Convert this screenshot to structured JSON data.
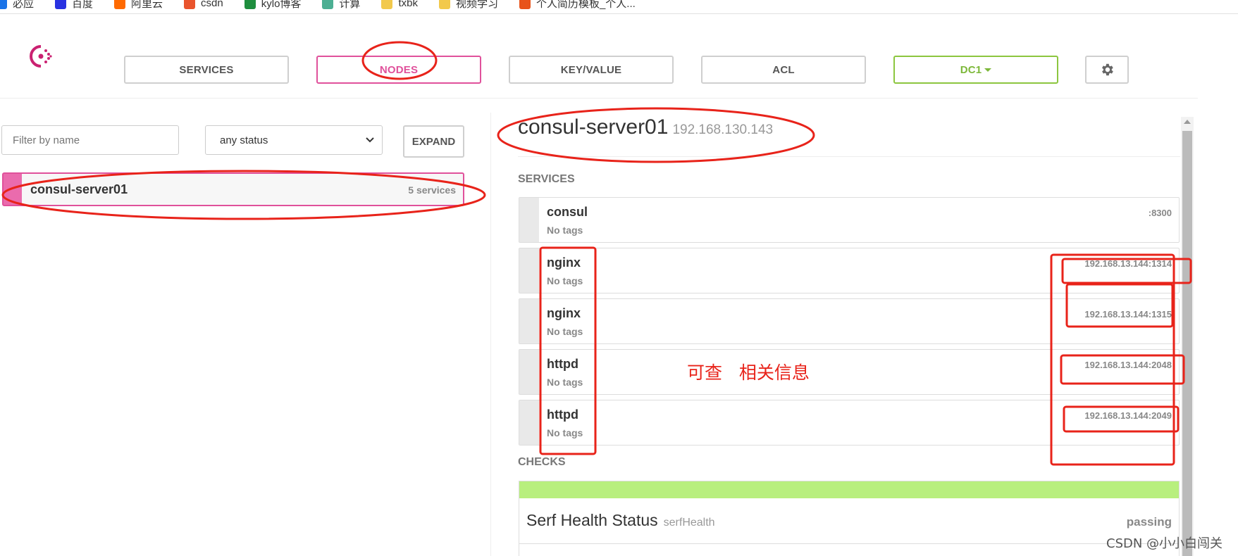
{
  "bookmarks": [
    {
      "label": "必应",
      "color": "#1a73e8"
    },
    {
      "label": "百度",
      "color": "#2932e1"
    },
    {
      "label": "阿里云",
      "color": "#ff6a00"
    },
    {
      "label": "csdn",
      "color": "#e9542d"
    },
    {
      "label": "kylo博客",
      "color": "#1e8e3e"
    },
    {
      "label": "计算",
      "color": "#4caf93"
    },
    {
      "label": "txbk",
      "color": "#f2c94c"
    },
    {
      "label": "视频学习",
      "color": "#f2c94c"
    },
    {
      "label": "个人简历模板_个人...",
      "color": "#e8531a"
    }
  ],
  "nav": {
    "services": "SERVICES",
    "nodes": "NODES",
    "keyvalue": "KEY/VALUE",
    "acl": "ACL",
    "dc": "DC1",
    "settings_icon": "gear-icon"
  },
  "colors": {
    "accent": "#e0519b",
    "dc_green": "#8cc63f",
    "passing": "#b8ef7e",
    "annotation": "#e8231a"
  },
  "filters": {
    "name_placeholder": "Filter by name",
    "status_value": "any status",
    "expand": "EXPAND"
  },
  "nodes": [
    {
      "name": "consul-server01",
      "services": "5 services"
    }
  ],
  "detail": {
    "node_name": "consul-server01",
    "node_ip": "192.168.130.143",
    "services_heading": "SERVICES",
    "checks_heading": "CHECKS",
    "services": [
      {
        "name": "consul",
        "tags": "No tags",
        "address": ":8300"
      },
      {
        "name": "nginx",
        "tags": "No tags",
        "address": "192.168.13.144:1314"
      },
      {
        "name": "nginx",
        "tags": "No tags",
        "address": "192.168.13.144:1315"
      },
      {
        "name": "httpd",
        "tags": "No tags",
        "address": "192.168.13.144:2048"
      },
      {
        "name": "httpd",
        "tags": "No tags",
        "address": "192.168.13.144:2049"
      }
    ],
    "checks": [
      {
        "name": "Serf Health Status",
        "id": "serfHealth",
        "status": "passing"
      }
    ]
  },
  "annotation": {
    "text": "可查   相关信息"
  },
  "watermark": "CSDN @小小白闯关"
}
